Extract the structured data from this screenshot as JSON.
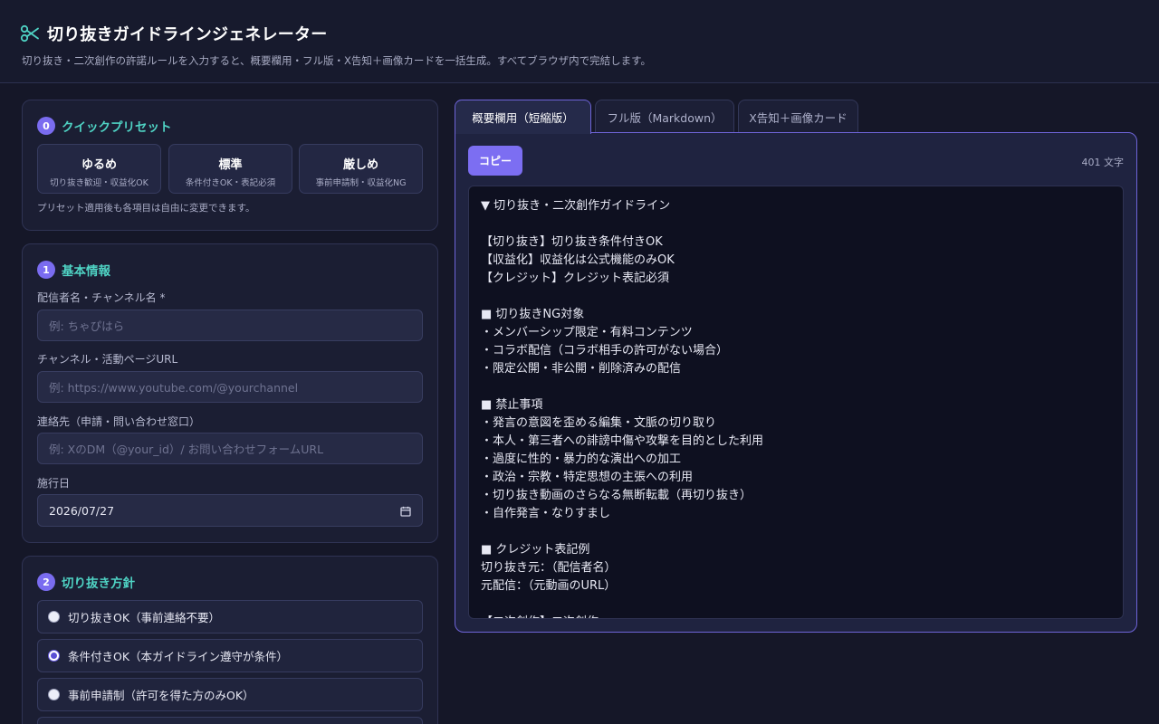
{
  "header": {
    "title": "切り抜きガイドラインジェネレーター",
    "subtitle": "切り抜き・二次創作の許諾ルールを入力すると、概要欄用・フル版・X告知＋画像カードを一括生成。すべてブラウザ内で完結します。",
    "icon": "scissors-icon"
  },
  "presets": {
    "badge": "0",
    "title": "クイックプリセット",
    "items": [
      {
        "name": "ゆるめ",
        "desc": "切り抜き歓迎・収益化OK"
      },
      {
        "name": "標準",
        "desc": "条件付きOK・表記必須"
      },
      {
        "name": "厳しめ",
        "desc": "事前申請制・収益化NG"
      }
    ],
    "note": "プリセット適用後も各項目は自由に変更できます。"
  },
  "basic": {
    "badge": "1",
    "title": "基本情報",
    "fields": [
      {
        "label": "配信者名・チャンネル名 *",
        "placeholder": "例: ちゃぴはら",
        "value": ""
      },
      {
        "label": "チャンネル・活動ページURL",
        "placeholder": "例: https://www.youtube.com/@yourchannel",
        "value": ""
      },
      {
        "label": "連絡先（申請・問い合わせ窓口）",
        "placeholder": "例: XのDM（@your_id）/ お問い合わせフォームURL",
        "value": ""
      },
      {
        "label": "施行日",
        "placeholder": "",
        "value": "2026/07/27"
      }
    ]
  },
  "policy": {
    "badge": "2",
    "title": "切り抜き方針",
    "options": [
      {
        "label": "切り抜きOK（事前連絡不要）",
        "selected": false
      },
      {
        "label": "条件付きOK（本ガイドライン遵守が条件）",
        "selected": true
      },
      {
        "label": "事前申請制（許可を得た方のみOK）",
        "selected": false
      }
    ]
  },
  "tabs": [
    {
      "label": "概要欄用（短縮版）",
      "active": true
    },
    {
      "label": "フル版（Markdown）",
      "active": false
    },
    {
      "label": "X告知＋画像カード",
      "active": false
    }
  ],
  "output": {
    "copy_label": "コピー",
    "char_count": "401 文字",
    "lines": [
      "▼ 切り抜き・二次創作ガイドライン",
      "",
      "【切り抜き】切り抜き条件付きOK",
      "【収益化】収益化は公式機能のみOK",
      "【クレジット】クレジット表記必須",
      "",
      "■ 切り抜きNG対象",
      "・メンバーシップ限定・有料コンテンツ",
      "・コラボ配信（コラボ相手の許可がない場合）",
      "・限定公開・非公開・削除済みの配信",
      "",
      "■ 禁止事項",
      "・発言の意図を歪める編集・文脈の切り取り",
      "・本人・第三者への誹謗中傷や攻撃を目的とした利用",
      "・過度に性的・暴力的な演出への加工",
      "・政治・宗教・特定思想の主張への利用",
      "・切り抜き動画のさらなる無断転載（再切り抜き）",
      "・自作発言・なりすまし",
      "",
      "■ クレジット表記例",
      "切り抜き元：（配信者名）",
      "元配信：（元動画のURL）",
      "",
      "【二次創作】二次創作"
    ]
  },
  "colors": {
    "background": "#151728",
    "accent": "#7c6ef2",
    "teal": "#4fd3c4"
  }
}
